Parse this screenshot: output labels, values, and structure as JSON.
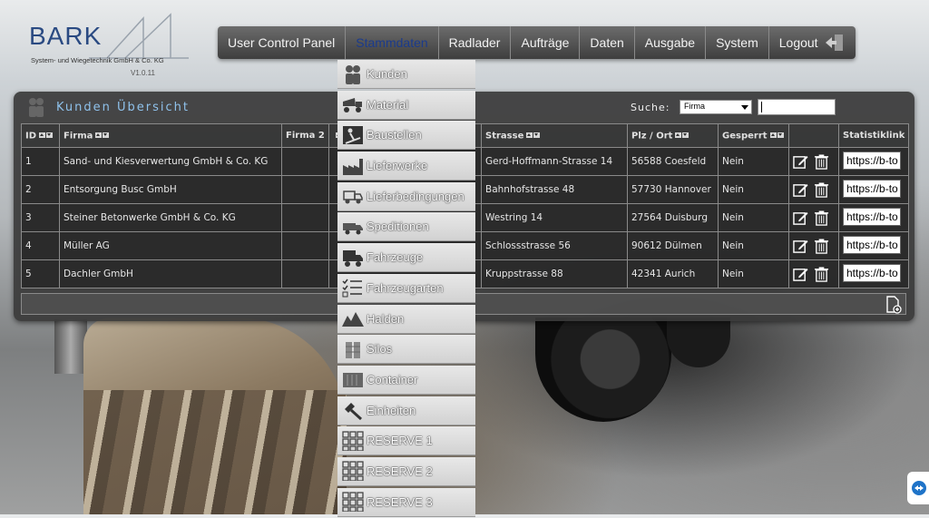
{
  "logo": {
    "title": "BARK",
    "subtitle": "System- und Wiegetechnik GmbH & Co. KG",
    "version": "V1.0.11"
  },
  "nav": {
    "items": [
      "User Control Panel",
      "Stammdaten",
      "Radlader",
      "Aufträge",
      "Daten",
      "Ausgabe",
      "System",
      "Logout"
    ],
    "active": "Stammdaten"
  },
  "dropdown": {
    "items": [
      {
        "label": "Kunden",
        "icon": "people-icon"
      },
      {
        "label": "Material",
        "icon": "dump-truck-icon"
      },
      {
        "label": "Baustellen",
        "icon": "construction-worker-icon"
      },
      {
        "label": "Lieferwerke",
        "icon": "factory-icon"
      },
      {
        "label": "Lieferbedingungen",
        "icon": "delivery-truck-icon"
      },
      {
        "label": "Speditionen",
        "icon": "truck-icon"
      },
      {
        "label": "Fahrzeuge",
        "icon": "lorry-icon"
      },
      {
        "label": "Fahrzeugarten",
        "icon": "checklist-icon"
      },
      {
        "label": "Halden",
        "icon": "mountain-icon"
      },
      {
        "label": "Silos",
        "icon": "silo-icon"
      },
      {
        "label": "Container",
        "icon": "container-icon"
      },
      {
        "label": "Einheiten",
        "icon": "hammer-icon"
      },
      {
        "label": "RESERVE 1",
        "icon": "grid-icon"
      },
      {
        "label": "RESERVE 2",
        "icon": "grid-icon"
      },
      {
        "label": "RESERVE 3",
        "icon": "grid-icon"
      }
    ]
  },
  "panel": {
    "title": "Kunden Übersicht",
    "search": {
      "label": "Suche:",
      "selected": "Firma",
      "value": ""
    }
  },
  "table": {
    "headers": [
      "ID",
      "Firma",
      "Firma 2",
      "",
      "Strasse",
      "Plz / Ort",
      "Gesperrt",
      "",
      "Statistiklink"
    ],
    "rows": [
      {
        "id": "1",
        "firma": "Sand- und Kiesverwertung GmbH & Co. KG",
        "firma2": "",
        "strasse": "Gerd-Hoffmann-Strasse 14",
        "plzort": "56588 Coesfeld",
        "gesperrt": "Nein",
        "link": "https://b-to"
      },
      {
        "id": "2",
        "firma": "Entsorgung Busc GmbH",
        "firma2": "",
        "strasse": "Bahnhofstrasse 48",
        "plzort": "57730 Hannover",
        "gesperrt": "Nein",
        "link": "https://b-to"
      },
      {
        "id": "3",
        "firma": "Steiner Betonwerke GmbH & Co. KG",
        "firma2": "",
        "strasse": "Westring 14",
        "plzort": "27564 Duisburg",
        "gesperrt": "Nein",
        "link": "https://b-to"
      },
      {
        "id": "4",
        "firma": "Müller AG",
        "firma2": "",
        "strasse": "Schlossstrasse 56",
        "plzort": "90612 Dülmen",
        "gesperrt": "Nein",
        "link": "https://b-to"
      },
      {
        "id": "5",
        "firma": "Dachler GmbH",
        "firma2": "",
        "strasse": "Kruppstrasse 88",
        "plzort": "42341 Aurich",
        "gesperrt": "Nein",
        "link": "https://b-to"
      }
    ]
  },
  "colors": {
    "title": "#8fc2ec",
    "nav_active": "#1b3b8c",
    "logo": "#2a4a82"
  }
}
